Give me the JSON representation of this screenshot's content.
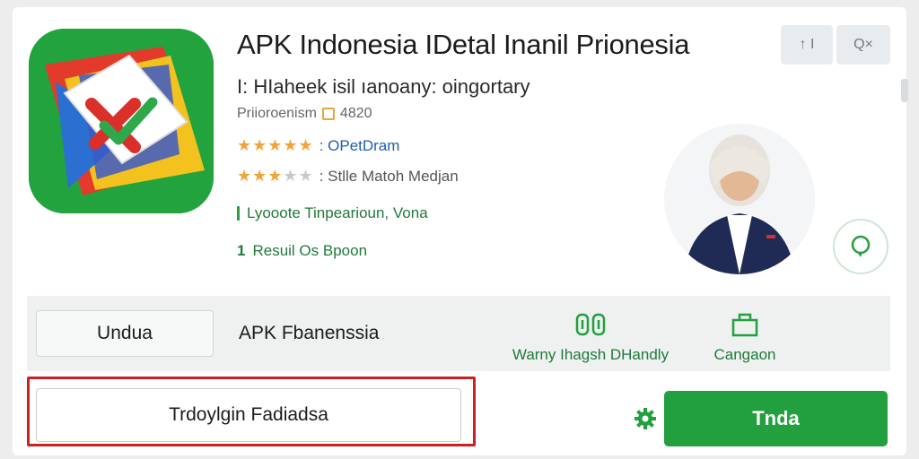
{
  "app": {
    "title": "APK Indonesia IDetal Inanil Prionesia",
    "subtitle": "I: HIaheek isil ıanoany: oingortary",
    "meta": "Priioroenism",
    "meta_value": "4820",
    "icon": "app-logo-check-cross"
  },
  "ratings": [
    {
      "stars_on": 5,
      "stars_total": 5,
      "label": ": OPetDram"
    },
    {
      "stars_on": 3,
      "stars_total": 5,
      "label": ": Stlle Matoh Medjan"
    }
  ],
  "highlights": [
    {
      "text": "Lyooote Tinpearioun, Vona"
    },
    {
      "num": "1",
      "text": "Resuil Os Bpoon"
    }
  ],
  "top_buttons": [
    {
      "icon": "info-icon",
      "label": "↑ I"
    },
    {
      "icon": "search-icon",
      "label": "Q×"
    }
  ],
  "strip": {
    "button_label": "Undua",
    "label": "APK Fbanenssia",
    "features": [
      {
        "icon": "toggle-icon",
        "label": "Warny Ihagsh DHandly"
      },
      {
        "icon": "bag-icon",
        "label": "Cangaon"
      }
    ]
  },
  "search": {
    "value": "Trdoylgin Fadiadsa"
  },
  "actions": {
    "download_label": "Tnda"
  },
  "colors": {
    "accent_green": "#23a03e",
    "highlight_red": "#cc1f1f",
    "star": "#f2a33a",
    "link_blue": "#1f5fb0"
  }
}
